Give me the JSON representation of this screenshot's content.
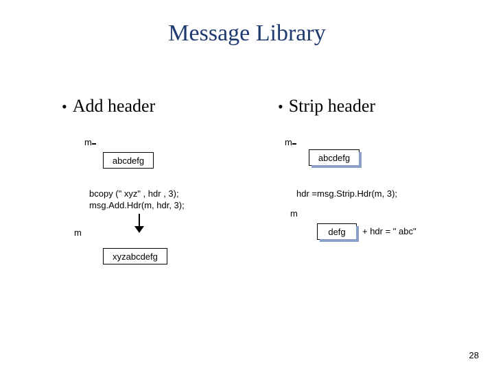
{
  "title": "Message Library",
  "left": {
    "bullet": "Add header",
    "m1": "m",
    "box1": "abcdefg",
    "code": "bcopy (\" xyz\" , hdr , 3);\nmsg.Add.Hdr(m, hdr, 3);",
    "m2": "m",
    "box2": "xyzabcdefg"
  },
  "right": {
    "bullet": "Strip header",
    "m1": "m",
    "box1": "abcdefg",
    "code": "hdr =msg.Strip.Hdr(m, 3);",
    "m2": "m",
    "box2": "defg",
    "result": "+ hdr = \" abc\""
  },
  "page": "28"
}
